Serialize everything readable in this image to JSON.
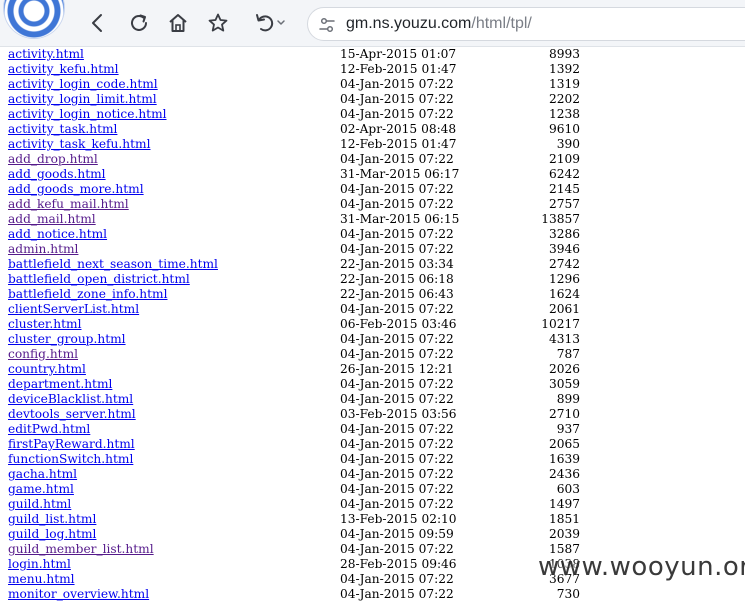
{
  "browser": {
    "url_host": "gm.ns.youzu.com",
    "url_path": "/html/tpl/",
    "icons": {
      "back": "arrow-left-icon",
      "reload": "reload-icon",
      "home": "home-icon",
      "favorite": "star-icon",
      "undo": "undo-icon",
      "site_info": "tune-icon"
    }
  },
  "listing": {
    "files": [
      {
        "name": "activity.html",
        "date": "15-Apr-2015 01:07",
        "size": "8993",
        "visited": false
      },
      {
        "name": "activity_kefu.html",
        "date": "12-Feb-2015 01:47",
        "size": "1392",
        "visited": false
      },
      {
        "name": "activity_login_code.html",
        "date": "04-Jan-2015 07:22",
        "size": "1319",
        "visited": false
      },
      {
        "name": "activity_login_limit.html",
        "date": "04-Jan-2015 07:22",
        "size": "2202",
        "visited": false
      },
      {
        "name": "activity_login_notice.html",
        "date": "04-Jan-2015 07:22",
        "size": "1238",
        "visited": false
      },
      {
        "name": "activity_task.html",
        "date": "02-Apr-2015 08:48",
        "size": "9610",
        "visited": false
      },
      {
        "name": "activity_task_kefu.html",
        "date": "12-Feb-2015 01:47",
        "size": "390",
        "visited": false
      },
      {
        "name": "add_drop.html",
        "date": "04-Jan-2015 07:22",
        "size": "2109",
        "visited": true
      },
      {
        "name": "add_goods.html",
        "date": "31-Mar-2015 06:17",
        "size": "6242",
        "visited": false
      },
      {
        "name": "add_goods_more.html",
        "date": "04-Jan-2015 07:22",
        "size": "2145",
        "visited": false
      },
      {
        "name": "add_kefu_mail.html",
        "date": "04-Jan-2015 07:22",
        "size": "2757",
        "visited": true
      },
      {
        "name": "add_mail.html",
        "date": "31-Mar-2015 06:15",
        "size": "13857",
        "visited": true
      },
      {
        "name": "add_notice.html",
        "date": "04-Jan-2015 07:22",
        "size": "3286",
        "visited": false
      },
      {
        "name": "admin.html",
        "date": "04-Jan-2015 07:22",
        "size": "3946",
        "visited": true
      },
      {
        "name": "battlefield_next_season_time.html",
        "date": "22-Jan-2015 03:34",
        "size": "2742",
        "visited": false
      },
      {
        "name": "battlefield_open_district.html",
        "date": "22-Jan-2015 06:18",
        "size": "1296",
        "visited": false
      },
      {
        "name": "battlefield_zone_info.html",
        "date": "22-Jan-2015 06:43",
        "size": "1624",
        "visited": false
      },
      {
        "name": "clientServerList.html",
        "date": "04-Jan-2015 07:22",
        "size": "2061",
        "visited": false
      },
      {
        "name": "cluster.html",
        "date": "06-Feb-2015 03:46",
        "size": "10217",
        "visited": false
      },
      {
        "name": "cluster_group.html",
        "date": "04-Jan-2015 07:22",
        "size": "4313",
        "visited": false
      },
      {
        "name": "config.html",
        "date": "04-Jan-2015 07:22",
        "size": "787",
        "visited": true
      },
      {
        "name": "country.html",
        "date": "26-Jan-2015 12:21",
        "size": "2026",
        "visited": false
      },
      {
        "name": "department.html",
        "date": "04-Jan-2015 07:22",
        "size": "3059",
        "visited": false
      },
      {
        "name": "deviceBlacklist.html",
        "date": "04-Jan-2015 07:22",
        "size": "899",
        "visited": false
      },
      {
        "name": "devtools_server.html",
        "date": "03-Feb-2015 03:56",
        "size": "2710",
        "visited": false
      },
      {
        "name": "editPwd.html",
        "date": "04-Jan-2015 07:22",
        "size": "937",
        "visited": false
      },
      {
        "name": "firstPayReward.html",
        "date": "04-Jan-2015 07:22",
        "size": "2065",
        "visited": false
      },
      {
        "name": "functionSwitch.html",
        "date": "04-Jan-2015 07:22",
        "size": "1639",
        "visited": false
      },
      {
        "name": "gacha.html",
        "date": "04-Jan-2015 07:22",
        "size": "2436",
        "visited": false
      },
      {
        "name": "game.html",
        "date": "04-Jan-2015 07:22",
        "size": "603",
        "visited": false
      },
      {
        "name": "guild.html",
        "date": "04-Jan-2015 07:22",
        "size": "1497",
        "visited": false
      },
      {
        "name": "guild_list.html",
        "date": "13-Feb-2015 02:10",
        "size": "1851",
        "visited": false
      },
      {
        "name": "guild_log.html",
        "date": "04-Jan-2015 09:59",
        "size": "2039",
        "visited": false
      },
      {
        "name": "guild_member_list.html",
        "date": "04-Jan-2015 07:22",
        "size": "1587",
        "visited": true
      },
      {
        "name": "login.html",
        "date": "28-Feb-2015 09:46",
        "size": "1038",
        "visited": false
      },
      {
        "name": "menu.html",
        "date": "04-Jan-2015 07:22",
        "size": "3677",
        "visited": false
      },
      {
        "name": "monitor_overview.html",
        "date": "04-Jan-2015 07:22",
        "size": "730",
        "visited": false
      }
    ]
  },
  "watermark": {
    "text": "www.wooyun.org"
  }
}
